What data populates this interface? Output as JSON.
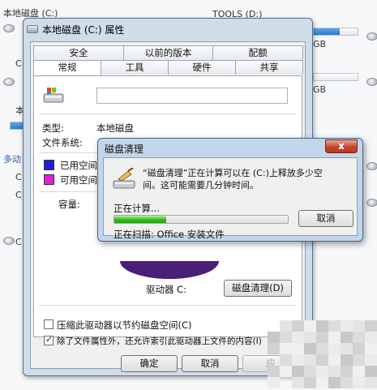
{
  "background": {
    "drive_c_label": "本地磁盘 (C:)",
    "drive_d_label": "TOOLS (D:)",
    "gb_1": "GB",
    "gb_2": "GB",
    "side_text": "多动",
    "fragments": [
      "C",
      "C",
      "C",
      "本",
      "C",
      "C",
      "C"
    ]
  },
  "properties_dialog": {
    "title": "本地磁盘 (C:) 属性",
    "tabs_row1": [
      "安全",
      "以前的版本",
      "配额"
    ],
    "tabs_row2": [
      "常规",
      "工具",
      "硬件",
      "共享"
    ],
    "active_tab": "常规",
    "type_label": "类型:",
    "type_value": "本地磁盘",
    "fs_label": "文件系统:",
    "used_label": "已用空间",
    "free_label": "可用空间",
    "capacity_label": "容量:",
    "drive_label": "驱动器 C:",
    "cleanup_button": "磁盘清理(D)",
    "compress_option": "压缩此驱动器以节约磁盘空间(C)",
    "index_option": "除了文件属性外，还允许索引此驱动器上文件的内容(I)",
    "ok_button": "确定",
    "cancel_button": "取消",
    "apply_button": "应",
    "used_color": "#1f1fd6",
    "free_color": "#e020d8"
  },
  "cleanup_dialog": {
    "title": "磁盘清理",
    "message_line1": "“磁盘清理”正在计算可以在 (C:)上释放多少空",
    "message_line2": "间。这可能需要几分钟时间。",
    "calculating": "正在计算...",
    "cancel_button": "取消",
    "scanning": "正在扫描:  Office 安装文件",
    "progress": 0.3,
    "close_glyph": "x"
  }
}
